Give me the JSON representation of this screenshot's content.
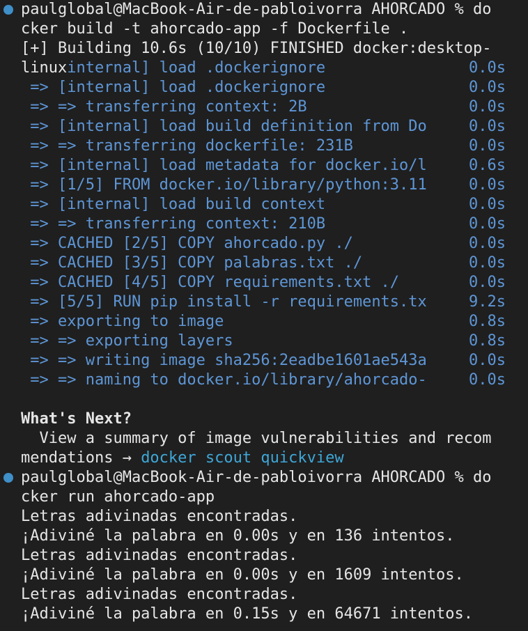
{
  "session1": {
    "prompt": "paulglobal@MacBook-Air-de-pabloivorra AHORCADO % do",
    "prompt_cont": "cker build -t ahorcado-app -f Dockerfile .",
    "building": "[+] Building 10.6s (10/10) FINISHED docker:desktop-",
    "linux_prefix": "linux",
    "linux_rest": "internal] load .dockerignore",
    "linux_time": "0.0s",
    "steps": [
      {
        "text": " => [internal] load .dockerignore",
        "time": "0.0s"
      },
      {
        "text": " => => transferring context: 2B",
        "time": "0.0s"
      },
      {
        "text": " => [internal] load build definition from Do",
        "time": "0.0s"
      },
      {
        "text": " => => transferring dockerfile: 231B",
        "time": "0.0s"
      },
      {
        "text": " => [internal] load metadata for docker.io/l",
        "time": "0.6s"
      },
      {
        "text": " => [1/5] FROM docker.io/library/python:3.11",
        "time": "0.0s"
      },
      {
        "text": " => [internal] load build context",
        "time": "0.0s"
      },
      {
        "text": " => => transferring context: 210B",
        "time": "0.0s"
      },
      {
        "text": " => CACHED [2/5] COPY ahorcado.py ./",
        "time": "0.0s"
      },
      {
        "text": " => CACHED [3/5] COPY palabras.txt ./",
        "time": "0.0s"
      },
      {
        "text": " => CACHED [4/5] COPY requirements.txt ./",
        "time": "0.0s"
      },
      {
        "text": " => [5/5] RUN pip install -r requirements.tx",
        "time": "9.2s"
      },
      {
        "text": " => exporting to image",
        "time": "0.8s"
      },
      {
        "text": " => => exporting layers",
        "time": "0.8s"
      },
      {
        "text": " => => writing image sha256:2eadbe1601ae543a",
        "time": "0.0s"
      },
      {
        "text": " => => naming to docker.io/library/ahorcado-",
        "time": "0.0s"
      }
    ],
    "whats_next": "What's Next?",
    "next_line1": "  View a summary of image vulnerabilities and recom",
    "next_line2_prefix": "mendations → ",
    "next_link": "docker scout quickview"
  },
  "session2": {
    "prompt": "paulglobal@MacBook-Air-de-pabloivorra AHORCADO % do",
    "prompt_cont": "cker run ahorcado-app",
    "output": [
      "Letras adivinadas encontradas.",
      "¡Adiviné la palabra en 0.00s y en 136 intentos.",
      "Letras adivinadas encontradas.",
      "¡Adiviné la palabra en 0.00s y en 1609 intentos.",
      "Letras adivinadas encontradas.",
      "¡Adiviné la palabra en 0.15s y en 64671 intentos."
    ]
  },
  "colors": {
    "background": "#1f1f1f",
    "text": "#e6e6e6",
    "build_step": "#5e96d6",
    "link": "#3ea7d8",
    "prompt_dot": "#3f8fc9"
  }
}
